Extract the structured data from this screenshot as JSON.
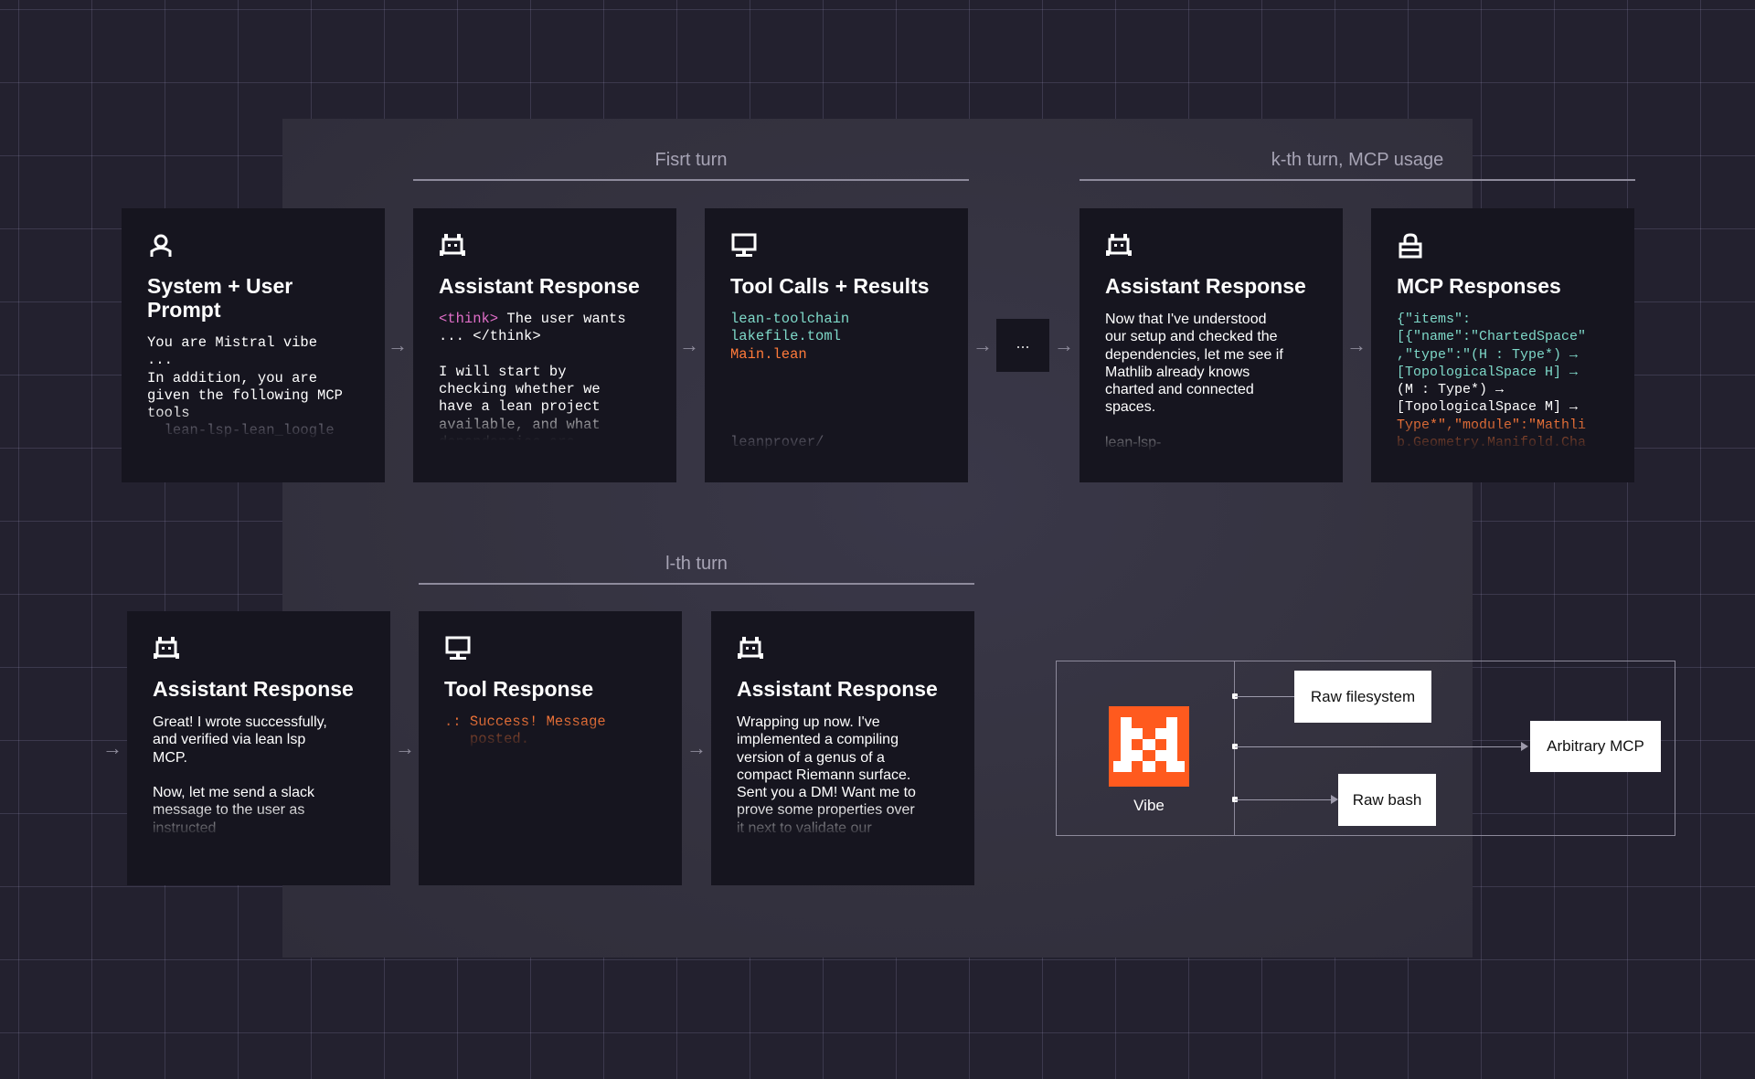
{
  "turns": {
    "first": "Fisrt turn",
    "kth": "k-th turn, MCP usage",
    "lth": "l-th turn"
  },
  "cards": {
    "system": {
      "icon": "person-icon",
      "title": "System + User Prompt",
      "lines": [
        "You are Mistral vibe",
        "...",
        "In addition, you are",
        "given the following MCP",
        "tools",
        "  lean-lsp-lean_loogle"
      ]
    },
    "assistant1": {
      "icon": "robot-icon",
      "title": "Assistant Response",
      "think_open": "<think>",
      "line1_rest": " The user wants",
      "line2": "... </think>",
      "body_rest": "I will start by\nchecking whether we\nhave a lean project\navailable, and what\ndependencies are"
    },
    "toolcalls": {
      "icon": "computer-icon",
      "title": "Tool Calls + Results",
      "file1": "lean-toolchain",
      "file2": "lakefile.toml",
      "file3": "Main.lean",
      "file4": "leanprover/"
    },
    "assistant2": {
      "icon": "robot-icon",
      "title": "Assistant Response",
      "body": "Now that I've understood\nour setup and checked the\ndependencies, let me see if\nMathlib already knows\ncharted and connected\nspaces.\n\nlean-lsp-"
    },
    "mcp": {
      "icon": "lock-icon",
      "title": "MCP Responses",
      "l1": "{\"items\":",
      "l2": "[{\"name\":\"ChartedSpace\"",
      "l3": ",\"type\":\"(H : Type*) →",
      "l4": "[TopologicalSpace H] →",
      "l5": "(M : Type*) →",
      "l6": "[TopologicalSpace M] →",
      "l7": "Type*\",\"module\":\"Mathli",
      "l8": "b.Geometry.Manifold.Cha"
    },
    "assistant3": {
      "icon": "robot-icon",
      "title": "Assistant Response",
      "body": "Great! I wrote successfully,\nand verified via lean lsp\nMCP.\n\nNow, let me send a slack\nmessage to the user as\ninstructed"
    },
    "toolresponse": {
      "icon": "computer-icon",
      "title": "Tool Response",
      "prefix": ".:",
      "body": " Success! Message\n   posted."
    },
    "assistant4": {
      "icon": "robot-icon",
      "title": "Assistant Response",
      "body": "Wrapping up now. I've\nimplemented a compiling\nversion of a genus of a\ncompact Riemann surface.\nSent you a DM! Want me to\nprove some properties over\nit next to validate our\ndefinition?"
    }
  },
  "ellipsis": "...",
  "vibe": {
    "label": "Vibe",
    "targets": [
      "Raw filesystem",
      "Arbitrary MCP",
      "Raw bash"
    ],
    "logo_color": "#ff5a1e"
  },
  "colors": {
    "background": "#23212f",
    "card": "#16151f",
    "think": "#e06ec8",
    "file": "#7ed8c8",
    "highlight": "#ff7a3a"
  }
}
